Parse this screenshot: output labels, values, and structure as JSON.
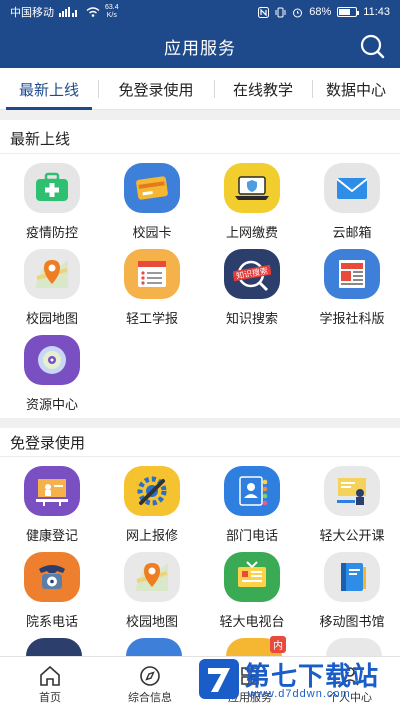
{
  "status_bar": {
    "carrier": "中国移动",
    "speed_value": "63.4",
    "speed_unit": "K/s",
    "battery": "68%",
    "battery_level": 0.68,
    "time": "11:43"
  },
  "header": {
    "title": "应用服务"
  },
  "tabs": [
    {
      "label": "最新上线"
    },
    {
      "label": "免登录使用"
    },
    {
      "label": "在线教学"
    },
    {
      "label": "数据中心"
    }
  ],
  "sections": [
    {
      "title": "最新上线",
      "items": [
        {
          "label": "疫情防控",
          "icon": "medical-kit-icon"
        },
        {
          "label": "校园卡",
          "icon": "campus-card-icon"
        },
        {
          "label": "上网缴费",
          "icon": "laptop-shield-icon"
        },
        {
          "label": "云邮箱",
          "icon": "mail-icon"
        },
        {
          "label": "校园地图",
          "icon": "map-pin-icon"
        },
        {
          "label": "轻工学报",
          "icon": "journal-list-icon"
        },
        {
          "label": "知识搜索",
          "icon": "knowledge-search-icon",
          "badge": "知识搜索"
        },
        {
          "label": "学报社科版",
          "icon": "newspaper-icon"
        },
        {
          "label": "资源中心",
          "icon": "disc-icon"
        }
      ]
    },
    {
      "title": "免登录使用",
      "items": [
        {
          "label": "健康登记",
          "icon": "presentation-icon"
        },
        {
          "label": "网上报修",
          "icon": "wrench-gear-icon"
        },
        {
          "label": "部门电话",
          "icon": "contacts-icon"
        },
        {
          "label": "轻大公开课",
          "icon": "open-course-icon"
        },
        {
          "label": "院系电话",
          "icon": "telephone-icon"
        },
        {
          "label": "校园地图",
          "icon": "map-pin-icon"
        },
        {
          "label": "轻大电视台",
          "icon": "tv-station-icon"
        },
        {
          "label": "移动图书馆",
          "icon": "book-icon"
        }
      ]
    }
  ],
  "partial_row": {
    "badge": "内"
  },
  "bottom_nav": [
    {
      "label": "首页",
      "icon": "home-icon"
    },
    {
      "label": "综合信息",
      "icon": "compass-icon"
    },
    {
      "label": "应用服务",
      "icon": "grid-icon"
    },
    {
      "label": "个人中心",
      "icon": "person-icon"
    }
  ],
  "watermark": {
    "text": "第七下载站",
    "url": "www.d7ddwn.com"
  },
  "colors": {
    "primary": "#1e4a8c",
    "watermark": "#1a5dc8"
  }
}
